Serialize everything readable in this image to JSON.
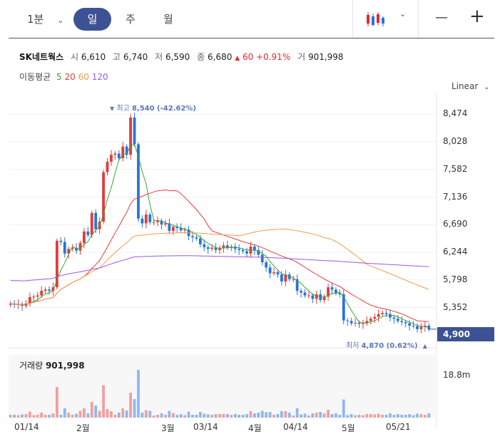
{
  "toolbar": {
    "interval": "1분",
    "periods": [
      "일",
      "주",
      "월"
    ],
    "zoom_out": "—",
    "zoom_in": "+"
  },
  "ticker": {
    "name": "SK네트웍스",
    "open_label": "시",
    "open": "6,610",
    "high_label": "고",
    "high": "6,740",
    "low_label": "저",
    "low": "6,590",
    "close_label": "종",
    "close": "6,680",
    "change": "60",
    "change_pct": "+0.91%",
    "volume_label": "거",
    "volume": "901,998"
  },
  "moving_avg": {
    "label": "이동평균",
    "periods": [
      "5",
      "20",
      "60",
      "120"
    ],
    "colors": [
      "#3aa53a",
      "#e63b3b",
      "#f39a4c",
      "#9b59e0"
    ]
  },
  "scale_mode": "Linear",
  "current_price": "4,900",
  "high_marker": {
    "prefix": "최고",
    "text": "8,540 (-42.62%)"
  },
  "low_marker": {
    "prefix": "최저",
    "text": "4,870 (0.62%)"
  },
  "volume_panel": {
    "label": "거래량",
    "value": "901,998",
    "axis_label": "18.8m"
  },
  "chart_data": {
    "type": "candlestick",
    "y_ticks": [
      "8,474",
      "8,028",
      "7,582",
      "7,136",
      "6,690",
      "6,244",
      "5,798",
      "5,352"
    ],
    "ylim": [
      4800,
      8600
    ],
    "x_ticks": [
      "01/14",
      "2월",
      "3월",
      "03/14",
      "4월",
      "04/14",
      "5월",
      "05/21"
    ],
    "close_series": [
      5340,
      5320,
      5330,
      5300,
      5340,
      5450,
      5460,
      5480,
      5560,
      5580,
      5560,
      5620,
      6420,
      6400,
      6200,
      6280,
      6300,
      6250,
      6380,
      6580,
      6520,
      6900,
      6620,
      6750,
      7600,
      7780,
      7900,
      7920,
      7840,
      8040,
      7900,
      8540,
      8080,
      6800,
      6720,
      6870,
      6740,
      6740,
      6760,
      6700,
      6720,
      6590,
      6660,
      6640,
      6600,
      6610,
      6500,
      6480,
      6460,
      6360,
      6310,
      6280,
      6300,
      6260,
      6300,
      6340,
      6300,
      6320,
      6280,
      6260,
      6240,
      6200,
      6320,
      6260,
      6180,
      6050,
      5960,
      5860,
      5880,
      5840,
      5720,
      5840,
      5760,
      5760,
      5560,
      5530,
      5480,
      5480,
      5420,
      5500,
      5400,
      5460,
      5620,
      5580,
      5520,
      5500,
      5050,
      5040,
      5000,
      5010,
      4990,
      5000,
      5040,
      5080,
      5110,
      5160,
      5180,
      5160,
      5100,
      5080,
      5040,
      5020,
      5000,
      4960,
      4950,
      4900,
      4940,
      4960,
      4900
    ],
    "volume_max": 18800000
  }
}
